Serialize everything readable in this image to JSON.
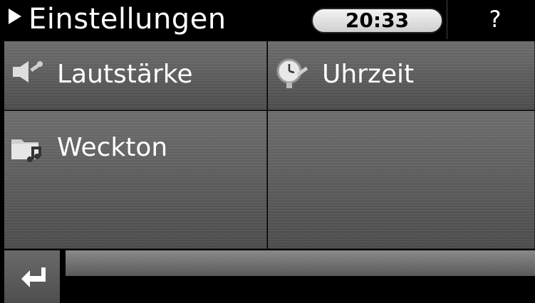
{
  "header": {
    "title": "Einstellungen",
    "clock": "20:33",
    "help": "?"
  },
  "menu": [
    {
      "label": "Lautstärke",
      "icon": "volume-wrench-icon"
    },
    {
      "label": "Uhrzeit",
      "icon": "clock-wrench-icon"
    },
    {
      "label": "Weckton",
      "icon": "music-folder-icon"
    }
  ],
  "footer": {
    "back_icon": "return-arrow-icon"
  }
}
